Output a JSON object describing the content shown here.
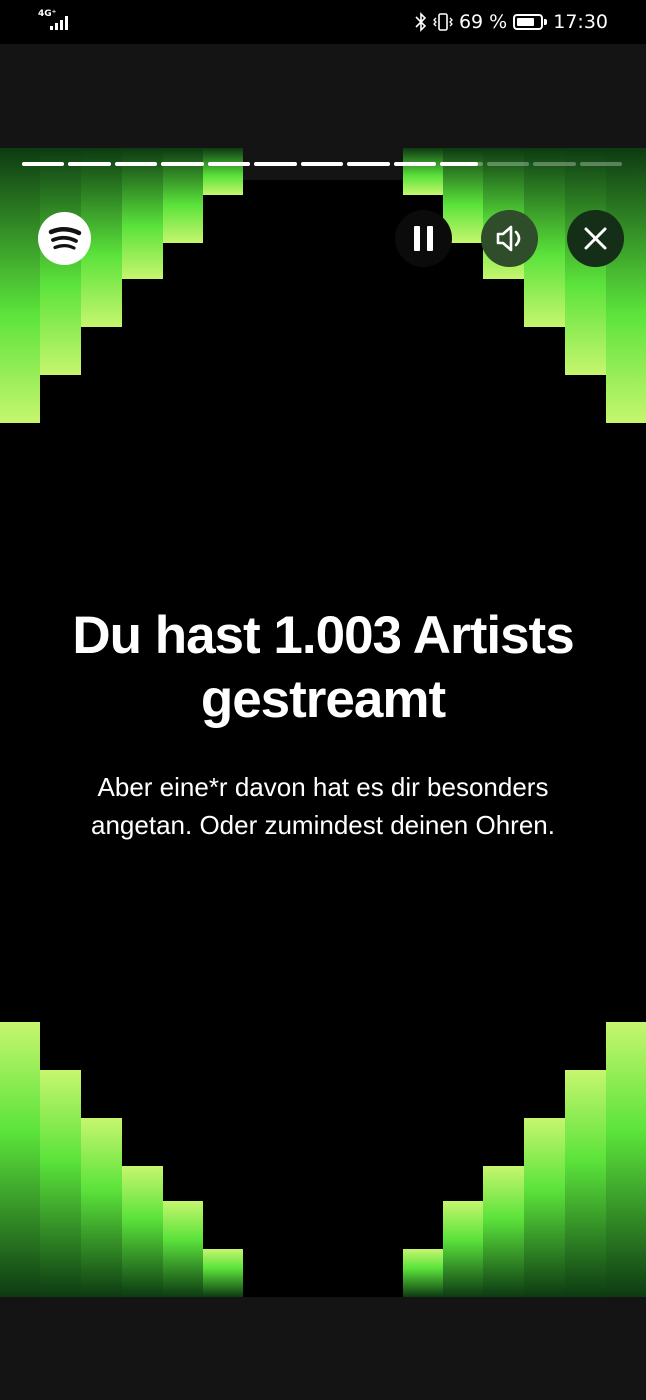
{
  "status_bar": {
    "network": "4G⁺",
    "battery": "69 %",
    "time": "17:30"
  },
  "story": {
    "segments_total": 13,
    "segments_completed": 9,
    "current_segment_progress": 0.88
  },
  "controls": {
    "logo_icon": "spotify-logo-icon",
    "pause_icon": "pause-icon",
    "sound_icon": "speaker-icon",
    "close_icon": "close-icon"
  },
  "content": {
    "headline_line1": "Du hast 1.003 Artists",
    "headline_line2": "gestreamt",
    "subtext_line1": "Aber eine*r davon hat es dir besonders",
    "subtext_line2": "angetan. Oder zumindest deinen Ohren."
  },
  "colors": {
    "accent_light": "#c6f66e",
    "accent_green": "#5be33b",
    "accent_dark": "#0d3a12",
    "background": "#000000"
  }
}
